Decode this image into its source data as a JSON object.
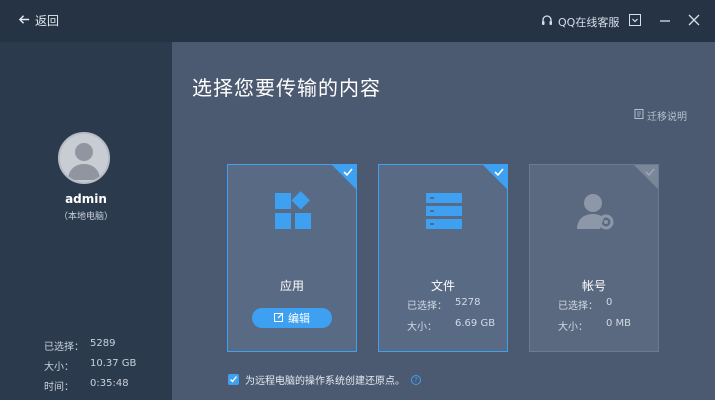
{
  "titlebar": {
    "back_label": "返回",
    "support_label": "QQ在线客服"
  },
  "sidebar": {
    "username": "admin",
    "user_desc": "（本地电脑）",
    "stats": [
      {
        "key": "已选择：",
        "value": "5289"
      },
      {
        "key": "大小：",
        "value": "10.37 GB"
      },
      {
        "key": "时间：",
        "value": "0:35:48"
      }
    ]
  },
  "main": {
    "title": "选择您要传输的内容",
    "help_label": "迁移说明",
    "cards": [
      {
        "label": "应用",
        "selected": true,
        "edit_label": "编辑"
      },
      {
        "label": "文件",
        "selected": true,
        "selected_key": "已选择：",
        "selected_count": "5278",
        "size_key": "大小：",
        "size_value": "6.69 GB"
      },
      {
        "label": "帐号",
        "selected": false,
        "selected_key": "已选择：",
        "selected_count": "0",
        "size_key": "大小：",
        "size_value": "0 MB"
      }
    ],
    "restore_label": "为远程电脑的操作系统创建还原点。",
    "restore_checked": true,
    "help_q": "?"
  },
  "colors": {
    "accent": "#3ea0f0",
    "titlebar": "#263345",
    "sidebar": "#2c3a4e",
    "main_bg": "#4b5a70",
    "card_bg": "#5a6980"
  },
  "icons": [
    "back-arrow-icon",
    "headset-icon",
    "minimize-icon",
    "close-icon",
    "user-avatar-icon",
    "doc-icon",
    "apps-icon",
    "files-icon",
    "account-gear-icon",
    "checkmark-icon",
    "edit-icon",
    "help-icon"
  ]
}
